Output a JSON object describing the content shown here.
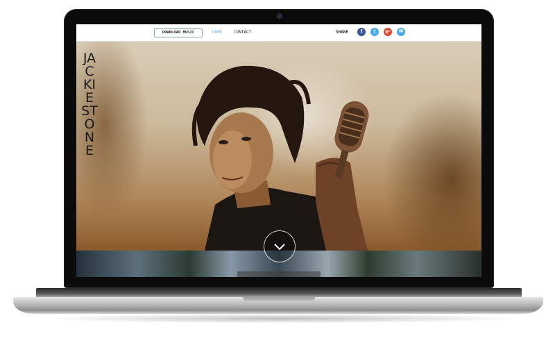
{
  "site": {
    "title": "JACKIE STONE"
  },
  "nav": {
    "download_label": "DOWNLOAD MUSIC",
    "home_label": "HOME",
    "contact_label": "CONTACT",
    "share_label": "SHARE"
  },
  "social": {
    "facebook": "f",
    "twitter": "t",
    "googleplus": "g+",
    "email": "✉"
  },
  "hero": {
    "image_subject": "singer-with-vintage-microphone"
  },
  "colors": {
    "nav_active": "#7fb0d8",
    "facebook": "#3b5998",
    "twitter": "#4aa9e9",
    "googleplus": "#dc4a38"
  },
  "icons": [
    "facebook-icon",
    "twitter-icon",
    "googleplus-icon",
    "email-icon",
    "chevron-down-icon"
  ]
}
